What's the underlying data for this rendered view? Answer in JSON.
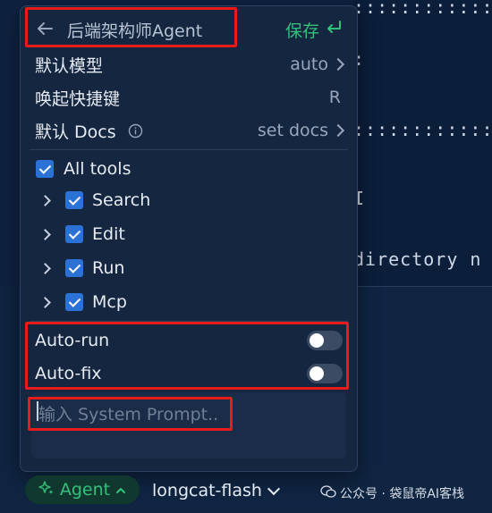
{
  "background": {
    "lines": [
      {
        "text": "::::::::::::N"
      },
      {
        "text": ":"
      },
      {
        "text": "::::::::::::"
      },
      {
        "text": "I"
      },
      {
        "text": "directory n"
      }
    ]
  },
  "header": {
    "title": "后端架构师Agent",
    "save_label": "保存",
    "save_icon": "enter-return-icon"
  },
  "settings": {
    "default_model": {
      "label": "默认模型",
      "value": "auto"
    },
    "shortcut": {
      "label": "唤起快捷键",
      "value": "R"
    },
    "default_docs": {
      "label": "默认 Docs",
      "value": "set docs"
    }
  },
  "tools": {
    "all_label": "All tools",
    "all_checked": true,
    "items": [
      {
        "label": "Search",
        "checked": true
      },
      {
        "label": "Edit",
        "checked": true
      },
      {
        "label": "Run",
        "checked": true
      },
      {
        "label": "Mcp",
        "checked": true
      }
    ]
  },
  "toggles": {
    "auto_run": {
      "label": "Auto-run",
      "on": false
    },
    "auto_fix": {
      "label": "Auto-fix",
      "on": false
    }
  },
  "prompt": {
    "placeholder": "输入 System Prompt.."
  },
  "footer": {
    "mode_label": "Agent",
    "model_label": "longcat-flash",
    "watermark": "公众号 · 袋鼠帝AI客栈"
  },
  "colors": {
    "accent_green": "#35c07a",
    "checkbox_blue": "#2b72d6",
    "highlight_red": "#e81b1b"
  }
}
